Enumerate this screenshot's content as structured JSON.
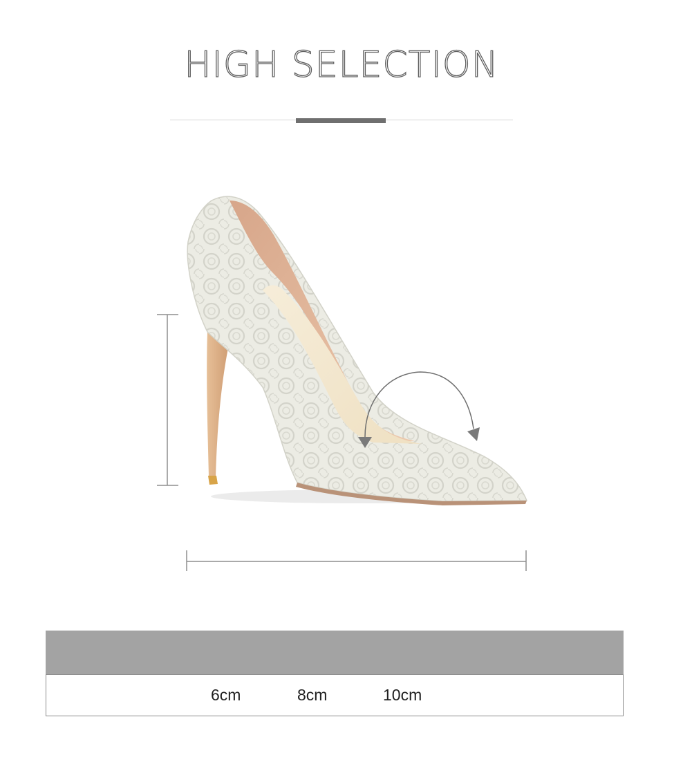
{
  "header": {
    "title": "HIGH SELECTION"
  },
  "product": {
    "image": "white-lace-pointed-toe-stiletto-pump",
    "colors": {
      "lace": "#eeeee6",
      "lining": "#d9b39a",
      "insole": "#f2e7cf",
      "heel_tip": "#d8a449",
      "measure_line": "#8e8e8e"
    }
  },
  "heel_height_table": {
    "header_color": "#a3a3a3",
    "options": [
      "6cm",
      "8cm",
      "10cm"
    ]
  }
}
